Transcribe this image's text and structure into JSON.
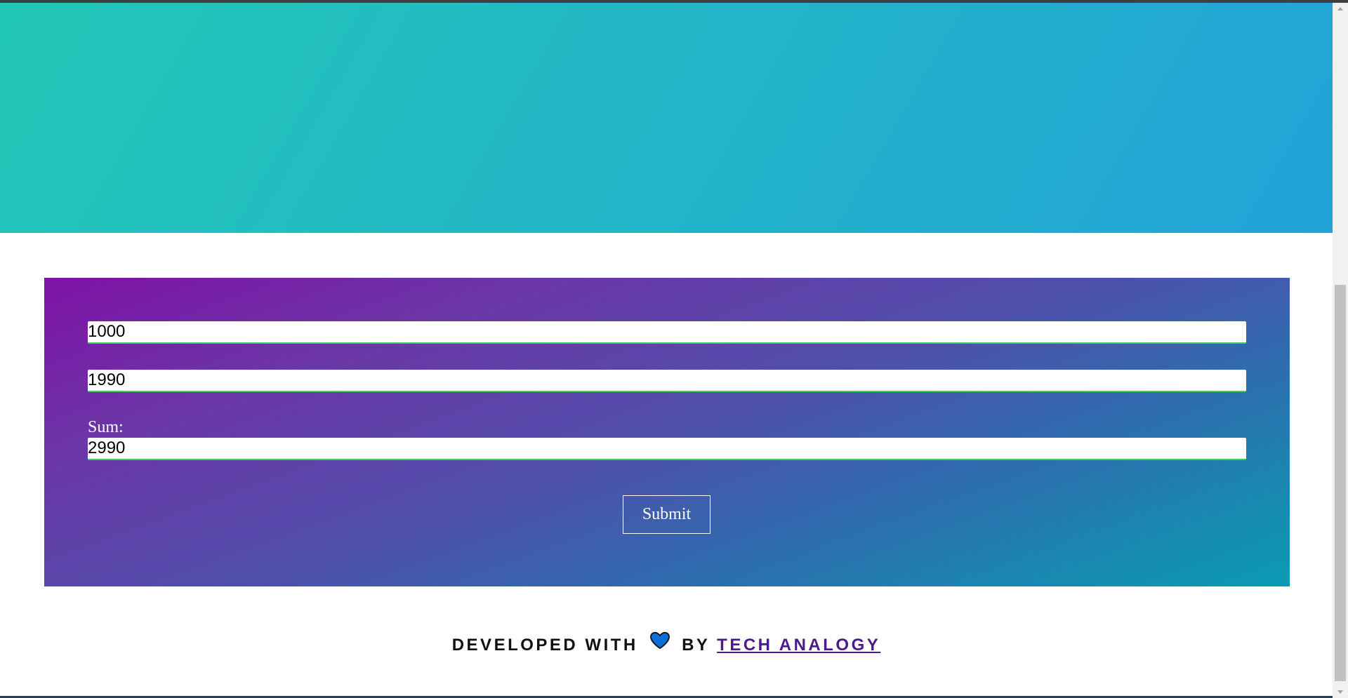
{
  "form": {
    "first_number": "1000",
    "second_number": "1990",
    "sum_label": "Sum:",
    "sum_value": "2990",
    "submit_label": "Submit"
  },
  "footer": {
    "prefix": "DEVELOPED WITH",
    "by": "BY",
    "author_link": "TECH ANALOGY",
    "heart_icon": "heart-icon",
    "heart_color": "#0a6fd6"
  },
  "colors": {
    "hero_start": "#22c8b6",
    "hero_end": "#22a3d8",
    "panel_start": "#7e12a5",
    "panel_end": "#0a9bb2",
    "input_underline": "#3dd05a",
    "link": "#4b1a8c"
  }
}
